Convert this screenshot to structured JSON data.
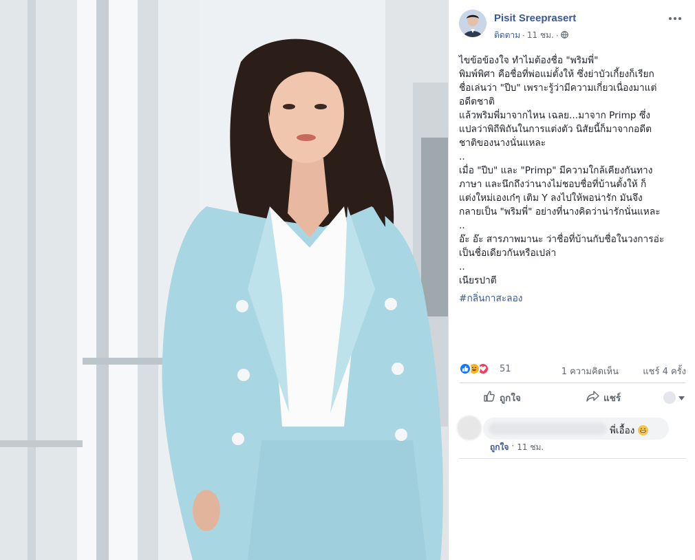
{
  "post": {
    "author": "Pisit Sreeprasert",
    "follow_label": "ติดตาม",
    "separator": "·",
    "time": "11 ชม.",
    "audience_separator": "·",
    "body": "ไขข้อข้องใจ ทำไมต้องชื่อ \"พริมพี่\"\nพิมพ์พิศา คือชื่อที่พ่อแม่ตั้งให้ ซึ่งย่าบัวเกี้ยงก็เรียก\nชื่อเล่นว่า \"ปีบ\" เพราะรู้ว่ามีความเกี่ยวเนื่องมาแต่\nอดีตชาติ\nแล้วพริมพี่มาจากไหน เฉลย...มาจาก Primp ซึ่ง\nแปลว่าพิถีพิถันในการแต่งตัว นิสัยนี้ก็มาจากอดีต\nชาติของนางนั่นแหละ\n..\nเมื่อ \"ปีบ\" และ \"Primp\" มีความใกล้เคียงกันทาง\nภาษา และนึกถึงว่านางไม่ชอบชื่อที่บ้านตั้งให้ ก็\nแต่งใหม่เองเก๋ๆ เติม Y ลงไปให้พอน่ารัก มันจึง\nกลายเป็น \"พริมพี่\" อย่างที่นางคิดว่าน่ารักนั่นแหละ\n..\nอ๊ะ อ๊ะ สารภาพมานะ ว่าชื่อที่บ้านกับชื่อในวงการอ่ะ\nเป็นชื่อเดียวกันหรือเปล่า\n..\nเนียรปาตี",
    "hashtag": "#กลิ่นกาสะลอง"
  },
  "stats": {
    "reaction_count": "51",
    "comments": "1 ความคิดเห็น",
    "shares": "แชร์ 4 ครั้ง"
  },
  "actions": {
    "like_label": "ถูกใจ",
    "share_label": "แชร์"
  },
  "comment": {
    "text": "พี่เอื้อง",
    "like_label": "ถูกใจ",
    "separator": "·",
    "time": "11 ชม."
  },
  "icons": {
    "like": "like-icon",
    "haha": "haha-icon",
    "love": "love-icon",
    "globe": "globe-icon",
    "more": "more-options-icon"
  },
  "colors": {
    "link": "#385898",
    "like_blue": "#1877f2",
    "love_red": "#f33e58",
    "haha_yellow": "#f7b125",
    "suit_blue": "#a9d6e3"
  }
}
